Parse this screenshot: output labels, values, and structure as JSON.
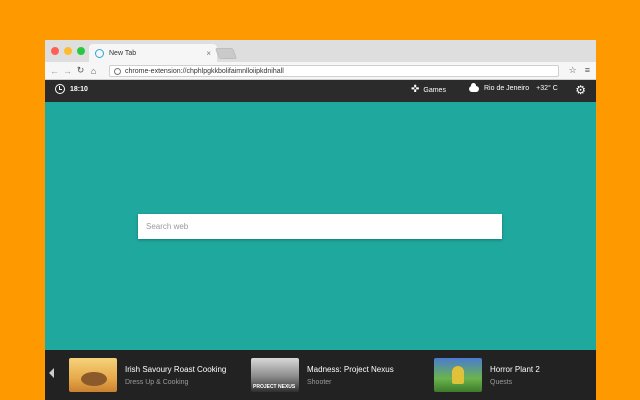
{
  "browser": {
    "tab_title": "New Tab",
    "tab_close": "×",
    "address": "chrome-extension://chphlpgkkbolifaimnlloiipkdnihall",
    "traffic_lights": [
      "#ff5f57",
      "#febc2e",
      "#28c840"
    ]
  },
  "toolbar": {
    "back": "←",
    "forward": "→",
    "reload": "↻",
    "home": "⌂",
    "bookmark": "☆",
    "menu": "≡"
  },
  "extension_bar": {
    "time": "18:10",
    "games_icon": "✜",
    "games_label": "Games",
    "city": "Rio de Jeneiro",
    "temperature": "+32° C",
    "settings_icon": "⚙"
  },
  "search": {
    "placeholder": "Search web"
  },
  "games": [
    {
      "title": "Irish Savoury Roast Cooking",
      "category": "Dress Up & Cooking"
    },
    {
      "title": "Madness: Project Nexus",
      "category": "Shooter"
    },
    {
      "title": "Horror Plant 2",
      "category": "Quests"
    }
  ],
  "colors": {
    "background": "#ff9900",
    "page": "#1fa99e",
    "extension_bar": "#2b2b2b",
    "footer": "#222222"
  }
}
